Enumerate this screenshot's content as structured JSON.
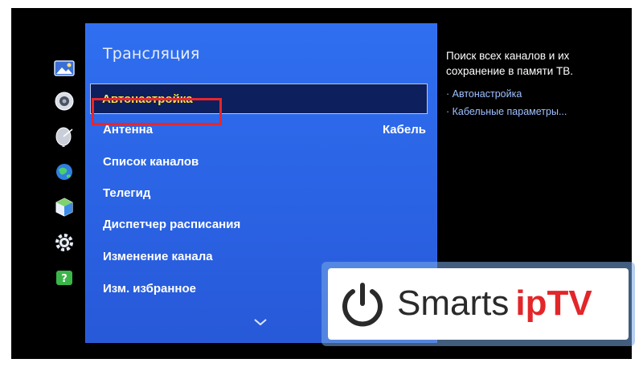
{
  "panel": {
    "title": "Трансляция",
    "menu": [
      {
        "label": "Автонастройка",
        "value": "",
        "selected": true
      },
      {
        "label": "Антенна",
        "value": "Кабель",
        "selected": false
      },
      {
        "label": "Список каналов",
        "value": "",
        "selected": false
      },
      {
        "label": "Телегид",
        "value": "",
        "selected": false
      },
      {
        "label": "Диспетчер расписания",
        "value": "",
        "selected": false
      },
      {
        "label": "Изменение канала",
        "value": "",
        "selected": false
      },
      {
        "label": "Изм. избранное",
        "value": "",
        "selected": false
      }
    ]
  },
  "help": {
    "description": "Поиск всех каналов и их сохранение в памяти ТВ.",
    "links": [
      "· Автонастройка",
      "· Кабельные параметры..."
    ]
  },
  "sidebar": {
    "icons": [
      "picture-icon",
      "sound-icon",
      "broadcast-icon",
      "network-icon",
      "smart-hub-icon",
      "settings-icon",
      "support-icon"
    ]
  },
  "watermark": {
    "brand_part1": "Smarts",
    "brand_part2": "ipTV"
  },
  "colors": {
    "panel_bg": "#2f6ff0",
    "selected_bg": "#0d1f5c",
    "selected_text": "#f3e44a",
    "highlight_border": "#e6262c",
    "link_text": "#9fc0ff",
    "brand_red": "#e2262a"
  }
}
